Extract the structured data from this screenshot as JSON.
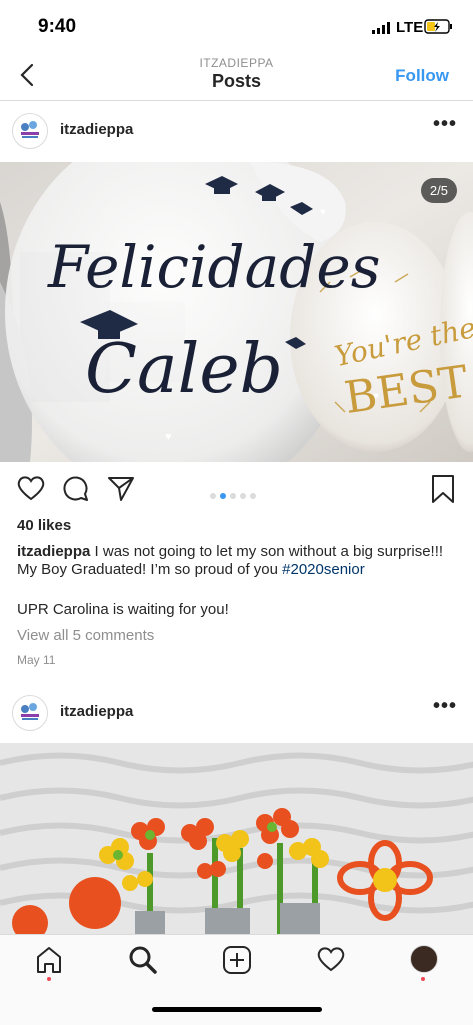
{
  "status_bar": {
    "time": "9:40",
    "network": "LTE"
  },
  "header": {
    "username_caps": "ITZADIEPPA",
    "title": "Posts",
    "follow_label": "Follow"
  },
  "post1": {
    "username": "itzadieppa",
    "image_counter": "2/5",
    "balloon_text": {
      "line1": "Felicidades",
      "line2": "Caleb",
      "gold1": "You're the",
      "gold2": "BEST"
    },
    "likes": "40 likes",
    "caption_user": "itzadieppa",
    "caption_text": " I was not going to let my son without a big surprise!!! My Boy Graduated! I’m so proud of you ",
    "hashtag": "#2020senior",
    "caption_line2": "UPR Carolina is waiting for you!",
    "view_comments": "View all 5 comments",
    "date": "May 11",
    "carousel": {
      "count": 5,
      "active": 2
    }
  },
  "post2": {
    "username": "itzadieppa"
  },
  "colors": {
    "accent": "#3897f0",
    "hashtag": "#003569",
    "muted": "#8e8e8e",
    "notification": "#ed4956"
  },
  "icons": [
    "back-chevron-icon",
    "more-options-icon",
    "heart-icon",
    "comment-icon",
    "share-icon",
    "bookmark-icon",
    "home-icon",
    "search-icon",
    "add-post-icon",
    "activity-heart-icon",
    "profile-avatar"
  ]
}
